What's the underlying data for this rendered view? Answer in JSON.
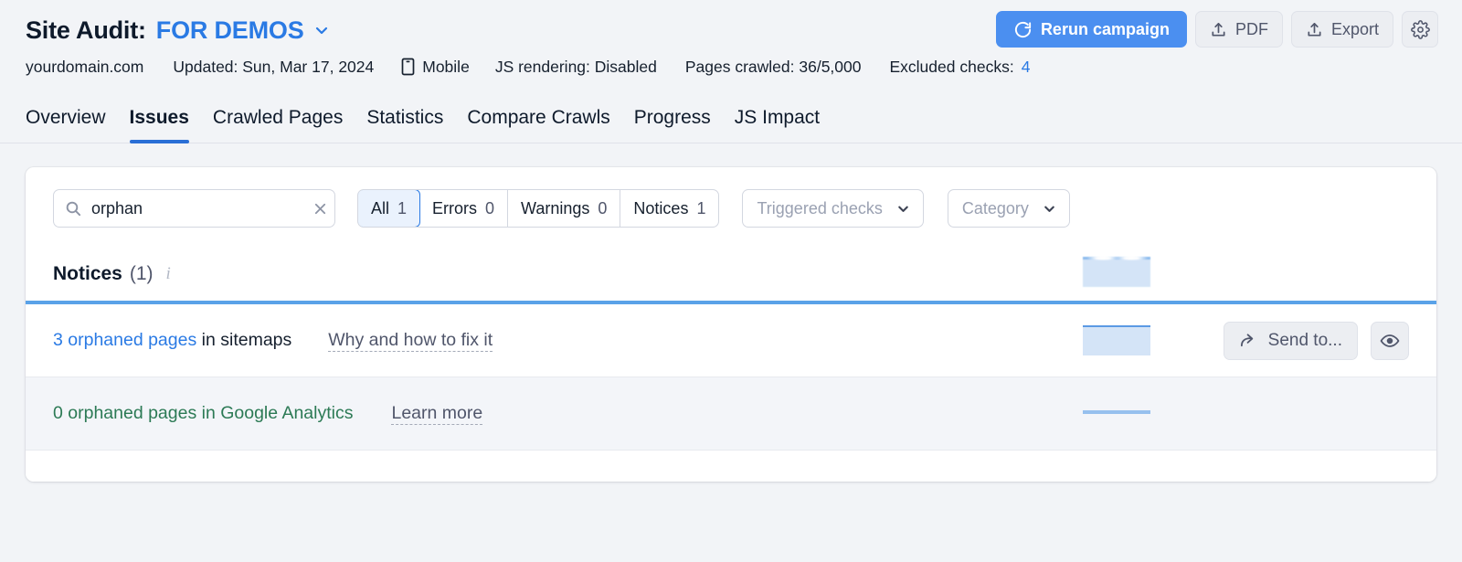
{
  "header": {
    "title_static": "Site Audit:",
    "campaign_name": "FOR DEMOS",
    "caret_icon": "chevron-down-icon",
    "actions": {
      "rerun_label": "Rerun campaign",
      "rerun_icon": "refresh-icon",
      "pdf_label": "PDF",
      "pdf_icon": "upload-icon",
      "export_label": "Export",
      "export_icon": "upload-icon",
      "settings_icon": "gear-icon"
    },
    "meta": {
      "domain": "yourdomain.com",
      "updated": "Updated: Sun, Mar 17, 2024",
      "device_icon": "mobile-icon",
      "device": "Mobile",
      "js_rendering": "JS rendering: Disabled",
      "pages_crawled": "Pages crawled: 36/5,000",
      "excluded_label": "Excluded checks:",
      "excluded_count": "4"
    }
  },
  "tabs": [
    {
      "label": "Overview",
      "active": false
    },
    {
      "label": "Issues",
      "active": true
    },
    {
      "label": "Crawled Pages",
      "active": false
    },
    {
      "label": "Statistics",
      "active": false
    },
    {
      "label": "Compare Crawls",
      "active": false
    },
    {
      "label": "Progress",
      "active": false
    },
    {
      "label": "JS Impact",
      "active": false
    }
  ],
  "filters": {
    "search": {
      "value": "orphan",
      "placeholder": "Search",
      "icon": "search-icon",
      "clear_icon": "close-icon"
    },
    "segments": [
      {
        "label": "All",
        "count": "1",
        "active": true
      },
      {
        "label": "Errors",
        "count": "0",
        "active": false
      },
      {
        "label": "Warnings",
        "count": "0",
        "active": false
      },
      {
        "label": "Notices",
        "count": "1",
        "active": false
      }
    ],
    "triggered_checks": {
      "label": "Triggered checks",
      "icon": "chevron-down-icon"
    },
    "category": {
      "label": "Category",
      "icon": "chevron-down-icon"
    }
  },
  "section": {
    "title": "Notices",
    "count": "(1)",
    "info_icon": "info-icon"
  },
  "issues": [
    {
      "link_text": "3 orphaned pages",
      "rest_text": " in sitemaps",
      "fix_link": "Why and how to fix it",
      "send_to_label": "Send to...",
      "send_to_icon": "share-arrow-icon",
      "view_icon": "eye-icon"
    },
    {
      "full_text": "0 orphaned pages in Google Analytics",
      "fix_link": "Learn more"
    }
  ],
  "colors": {
    "brand_blue": "#2a7ae4",
    "primary_button": "#4b8ff0",
    "active_tab_underline": "#2a6fd6",
    "divider_blue": "#5aa2e8",
    "green_text": "#2c7a55",
    "page_background": "#f2f4f7"
  }
}
